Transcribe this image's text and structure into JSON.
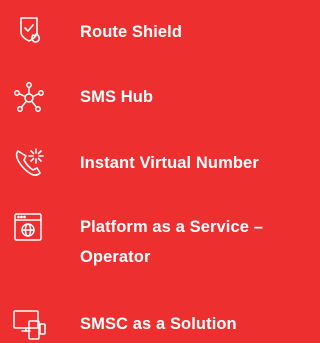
{
  "menu": {
    "items": [
      {
        "label": "Route Shield",
        "icon": "shield-fire-icon"
      },
      {
        "label": "SMS Hub",
        "icon": "network-hub-icon"
      },
      {
        "label": "Instant Virtual Number",
        "icon": "phone-spark-icon"
      },
      {
        "label": "Platform as a Service –\nOperator",
        "icon": "browser-globe-icon"
      },
      {
        "label": "SMSC as a Solution",
        "icon": "devices-icon"
      }
    ]
  },
  "colors": {
    "background": "#ee2f2f",
    "foreground": "#ffffff"
  }
}
